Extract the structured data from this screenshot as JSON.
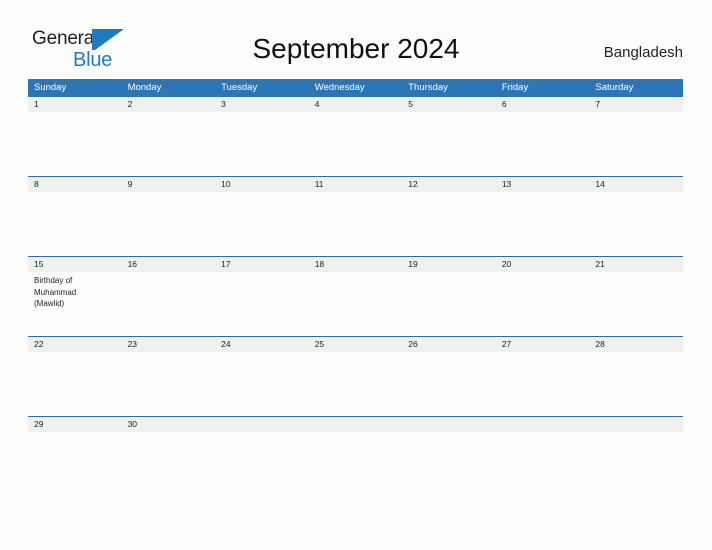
{
  "logo": {
    "word_dark": "General",
    "word_blue": "Blue",
    "accent_color": "#1f7ac4",
    "mark_icon": "triangle-flag-icon"
  },
  "header": {
    "title": "September 2024",
    "country": "Bangladesh"
  },
  "colors": {
    "header_blue": "#2e75b6",
    "row_divider_blue": "#2e6da4",
    "day_band_gray": "#f0f0f0",
    "page_background": "#fdfdfd"
  },
  "weekdays": [
    "Sunday",
    "Monday",
    "Tuesday",
    "Wednesday",
    "Thursday",
    "Friday",
    "Saturday"
  ],
  "weeks": [
    [
      {
        "date": "1",
        "event": ""
      },
      {
        "date": "2",
        "event": ""
      },
      {
        "date": "3",
        "event": ""
      },
      {
        "date": "4",
        "event": ""
      },
      {
        "date": "5",
        "event": ""
      },
      {
        "date": "6",
        "event": ""
      },
      {
        "date": "7",
        "event": ""
      }
    ],
    [
      {
        "date": "8",
        "event": ""
      },
      {
        "date": "9",
        "event": ""
      },
      {
        "date": "10",
        "event": ""
      },
      {
        "date": "11",
        "event": ""
      },
      {
        "date": "12",
        "event": ""
      },
      {
        "date": "13",
        "event": ""
      },
      {
        "date": "14",
        "event": ""
      }
    ],
    [
      {
        "date": "15",
        "event": "Birthday of\nMuhammad\n(Mawlid)"
      },
      {
        "date": "16",
        "event": ""
      },
      {
        "date": "17",
        "event": ""
      },
      {
        "date": "18",
        "event": ""
      },
      {
        "date": "19",
        "event": ""
      },
      {
        "date": "20",
        "event": ""
      },
      {
        "date": "21",
        "event": ""
      }
    ],
    [
      {
        "date": "22",
        "event": ""
      },
      {
        "date": "23",
        "event": ""
      },
      {
        "date": "24",
        "event": ""
      },
      {
        "date": "25",
        "event": ""
      },
      {
        "date": "26",
        "event": ""
      },
      {
        "date": "27",
        "event": ""
      },
      {
        "date": "28",
        "event": ""
      }
    ],
    [
      {
        "date": "29",
        "event": ""
      },
      {
        "date": "30",
        "event": ""
      },
      {
        "date": "",
        "event": ""
      },
      {
        "date": "",
        "event": ""
      },
      {
        "date": "",
        "event": ""
      },
      {
        "date": "",
        "event": ""
      },
      {
        "date": "",
        "event": ""
      }
    ]
  ]
}
